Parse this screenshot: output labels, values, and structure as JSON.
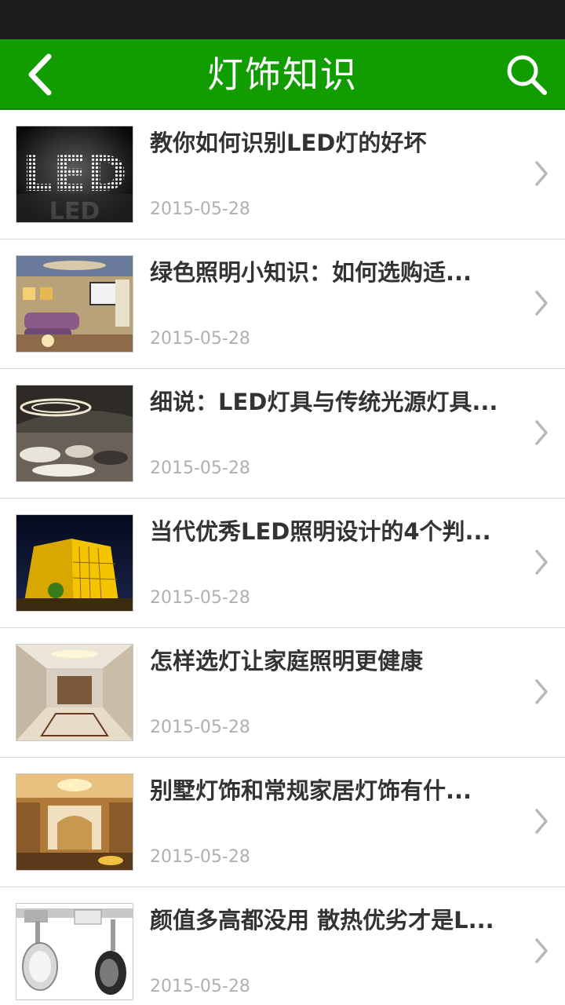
{
  "header": {
    "title": "灯饰知识",
    "back_icon": "chevron-left-icon",
    "search_icon": "search-icon",
    "background_color": "#119d00"
  },
  "articles": [
    {
      "title": "教你如何识别LED灯的好坏",
      "date": "2015-05-28",
      "thumbnail": "led-sign"
    },
    {
      "title": "绿色照明小知识：如何选购适...",
      "date": "2015-05-28",
      "thumbnail": "living-room"
    },
    {
      "title": "细说：LED灯具与传统光源灯具...",
      "date": "2015-05-28",
      "thumbnail": "modern-lounge"
    },
    {
      "title": "当代优秀LED照明设计的4个判...",
      "date": "2015-05-28",
      "thumbnail": "night-building"
    },
    {
      "title": "怎样选灯让家庭照明更健康",
      "date": "2015-05-28",
      "thumbnail": "hallway"
    },
    {
      "title": "别墅灯饰和常规家居灯饰有什...",
      "date": "2015-05-28",
      "thumbnail": "villa-interior"
    },
    {
      "title": "颜值多高都没用 散热优劣才是L...",
      "date": "2015-05-28",
      "thumbnail": "track-spotlight"
    }
  ]
}
